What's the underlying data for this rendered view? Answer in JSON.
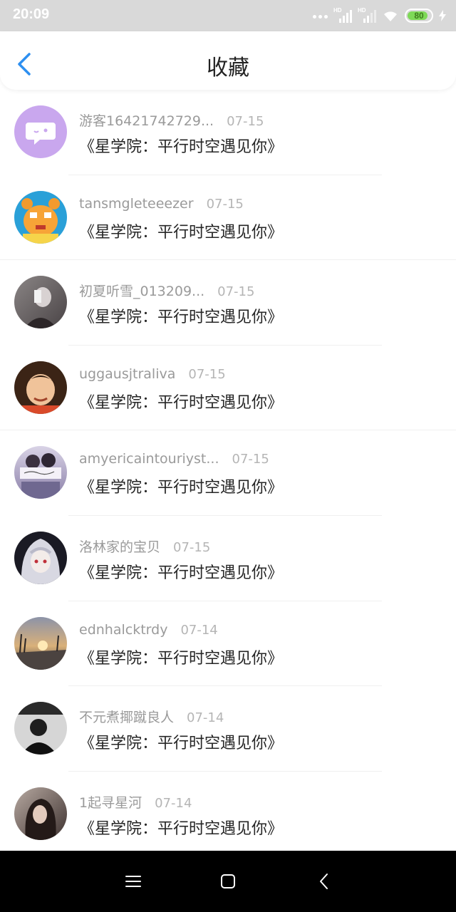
{
  "status_bar": {
    "time": "20:09",
    "battery": "80",
    "signal_label": "HD"
  },
  "header": {
    "title": "收藏"
  },
  "items": [
    {
      "name": "游客16421742729...",
      "date": "07-15",
      "book": "《星学院：平行时空遇见你》"
    },
    {
      "name": "tansmgleteeezer",
      "date": "07-15",
      "book": "《星学院：平行时空遇见你》"
    },
    {
      "name": "初夏听雪_013209...",
      "date": "07-15",
      "book": "《星学院：平行时空遇见你》"
    },
    {
      "name": "uggausjtraliva",
      "date": "07-15",
      "book": "《星学院：平行时空遇见你》"
    },
    {
      "name": "amyericaintouriyst...",
      "date": "07-15",
      "book": "《星学院：平行时空遇见你》"
    },
    {
      "name": "洛林家的宝贝",
      "date": "07-15",
      "book": "《星学院：平行时空遇见你》"
    },
    {
      "name": "ednhalcktrdy",
      "date": "07-14",
      "book": "《星学院：平行时空遇见你》"
    },
    {
      "name": "不元煮揶蹴良人",
      "date": "07-14",
      "book": "《星学院：平行时空遇见你》"
    },
    {
      "name": "1起寻星河",
      "date": "07-14",
      "book": "《星学院：平行时空遇见你》"
    }
  ],
  "colors": {
    "accent": "#2d8ff0",
    "default_avatar": "#c9a7ee"
  }
}
